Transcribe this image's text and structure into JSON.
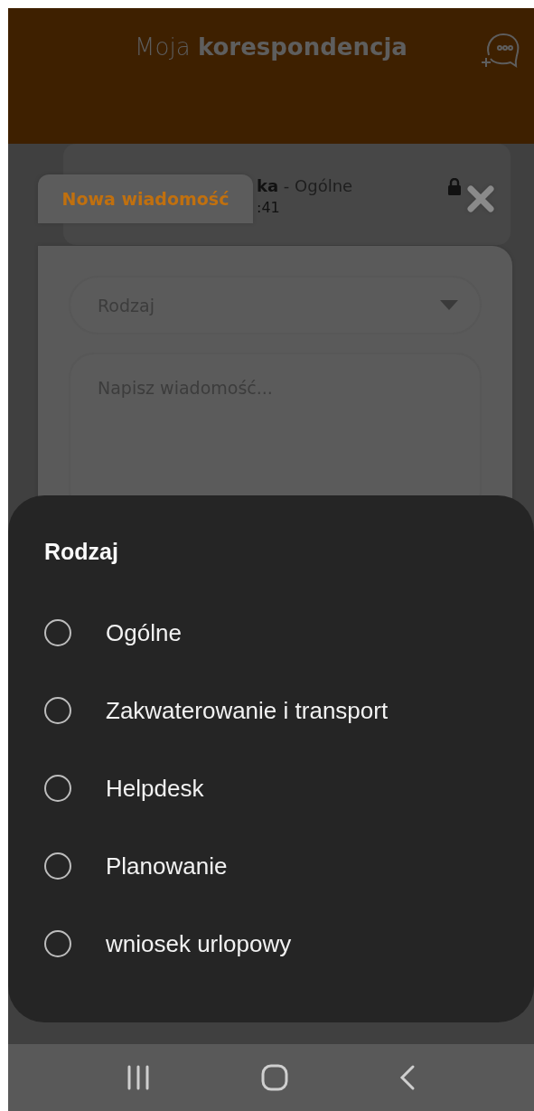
{
  "header": {
    "title": "Moja **korespondencja**"
  },
  "list_item": {
    "subject": "**ka** - Ogólne",
    "time": ":41"
  },
  "modal": {
    "tab": "Nowa wiadomość",
    "type_field": {
      "placeholder": "Rodzaj"
    },
    "message_field": {
      "placeholder": "Napisz wiadomość..."
    }
  },
  "sheet": {
    "title": "Rodzaj",
    "options": [
      {
        "label": "Ogólne",
        "selected": false
      },
      {
        "label": "Zakwaterowanie i transport",
        "selected": false
      },
      {
        "label": "Helpdesk",
        "selected": false
      },
      {
        "label": "Planowanie",
        "selected": false
      },
      {
        "label": "wniosek urlopowy",
        "selected": false
      }
    ]
  }
}
